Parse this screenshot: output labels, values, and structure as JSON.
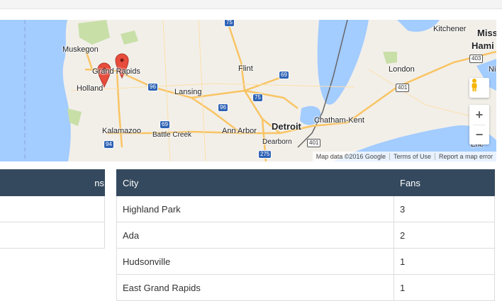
{
  "map": {
    "labels": {
      "muskegon": "Muskegon",
      "grand_rapids": "Grand Rapids",
      "holland": "Holland",
      "lansing": "Lansing",
      "flint": "Flint",
      "kalamazoo": "Kalamazoo",
      "battle_creek": "Battle Creek",
      "ann_arbor": "Ann Arbor",
      "detroit": "Detroit",
      "dearborn": "Dearborn",
      "chatham_kent": "Chatham-Kent",
      "london": "London",
      "kitchener": "Kitchener",
      "mississauga_partial": "Miss",
      "hamilton_partial": "Hami",
      "niagara_partial": "Ni",
      "erie_partial": "Erie"
    },
    "shields": {
      "i75_top": "75",
      "i69_flint": "69",
      "i96_gr": "96",
      "i96_lansing": "96",
      "i75_mid": "75",
      "i69_south": "69",
      "i94": "94",
      "i275": "275",
      "on401_detroit": "401",
      "on401_london": "401",
      "on403": "403"
    },
    "footer": {
      "data": "Map data ©2016 Google",
      "terms": "Terms of Use",
      "report": "Report a map error"
    },
    "zoom_in": "+",
    "zoom_out": "−",
    "colors": {
      "water": "#a3ccff",
      "land": "#f2efe9",
      "highway": "#f9c463",
      "marker": "#e74c3c",
      "park": "#c8dfa8"
    }
  },
  "left_table": {
    "header": "ns"
  },
  "right_table": {
    "headers": [
      "City",
      "Fans"
    ],
    "rows": [
      {
        "city": "Highland Park",
        "fans": "3"
      },
      {
        "city": "Ada",
        "fans": "2"
      },
      {
        "city": "Hudsonville",
        "fans": "1"
      },
      {
        "city": "East Grand Rapids",
        "fans": "1"
      }
    ]
  }
}
